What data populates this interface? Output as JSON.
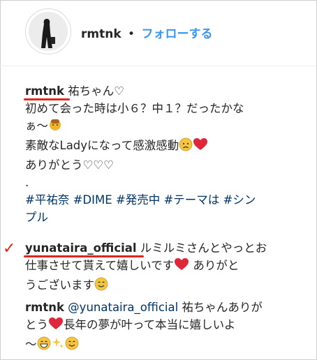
{
  "post": {
    "author": "rmtnk",
    "separator": "•",
    "follow_label": "フォローする"
  },
  "caption": {
    "username": "rmtnk",
    "line1_text": " 祐ちゃん♡",
    "line2_text": "初めて会った時は小６？中１？だったかな",
    "line3_text": "ぁ〜",
    "line4_text": "素敵なLadyになって感激感動",
    "line5_text": "ありがとう♡♡♡",
    "line6_text": ".",
    "hashtags_line1": "#平祐奈 #DIME #発売中 #テーマは #シン",
    "hashtags_line2": "プル"
  },
  "comments": [
    {
      "username": "yunataira_official",
      "line1_text": " ルミルミさんとやっとお",
      "line2_text": "仕事させて貰えて嬉しいです",
      "line2_after": " ありがと",
      "line3_text": "うございます"
    },
    {
      "username": "rmtnk",
      "mention": " @yunataira_official",
      "line1_text": " 祐ちゃんありが",
      "line2_text": "とう",
      "line2_after": "長年の夢が叶って本当に嬉しいよ",
      "line3_text": "〜"
    }
  ],
  "annotations": {
    "check_mark": "✓",
    "red_color": "#e0261f"
  },
  "colors": {
    "link_blue": "#3897f0",
    "hashtag_blue": "#003569",
    "text": "#262626"
  }
}
